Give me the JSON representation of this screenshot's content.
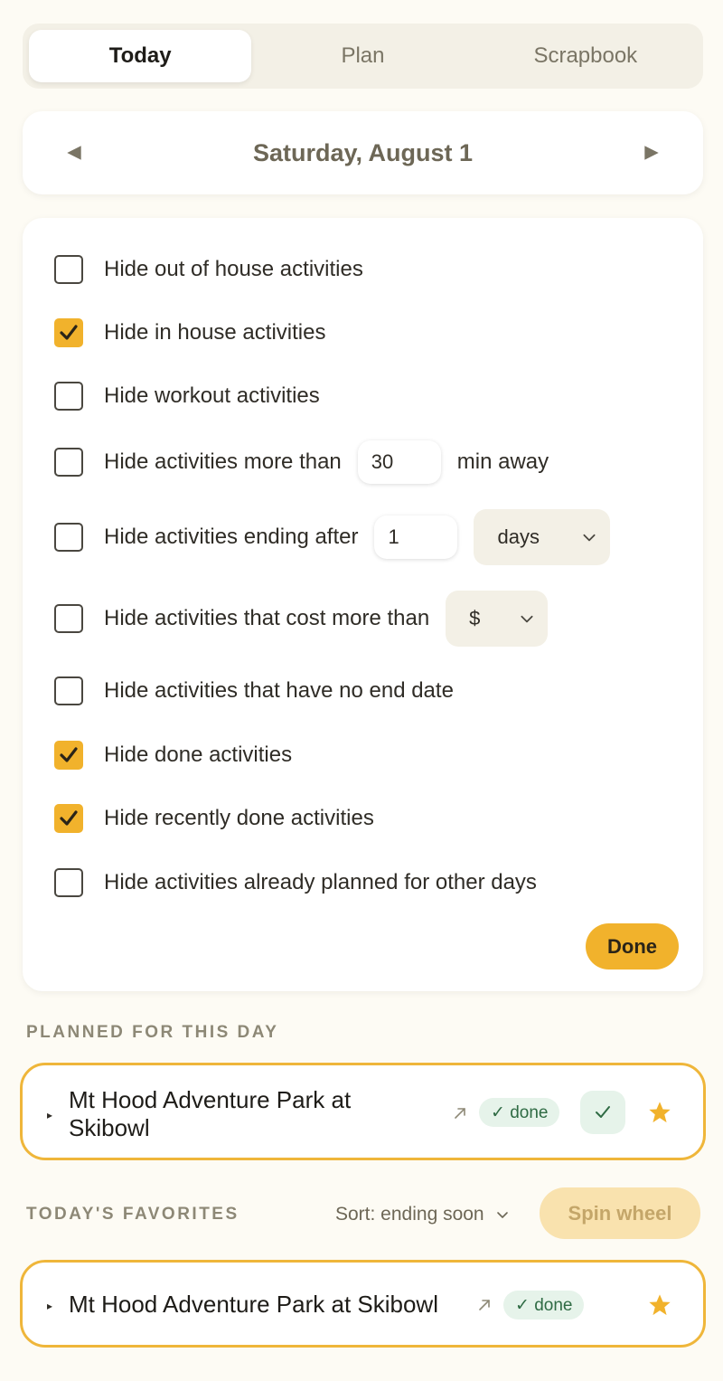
{
  "tabs": [
    {
      "label": "Today",
      "active": true
    },
    {
      "label": "Plan",
      "active": false
    },
    {
      "label": "Scrapbook",
      "active": false
    }
  ],
  "date_nav": {
    "date": "Saturday, August 1"
  },
  "filters": {
    "out_of_house": {
      "label": "Hide out of house activities",
      "checked": false
    },
    "in_house": {
      "label": "Hide in house activities",
      "checked": true
    },
    "workout": {
      "label": "Hide workout activities",
      "checked": false
    },
    "distance": {
      "label": "Hide activities more than",
      "value": "30",
      "suffix": "min away",
      "checked": false
    },
    "ending_after": {
      "label": "Hide activities ending after",
      "value": "1",
      "unit": "days",
      "checked": false
    },
    "cost": {
      "label": "Hide activities that cost more than",
      "value": "$",
      "checked": false
    },
    "no_end_date": {
      "label": "Hide activities that have no end date",
      "checked": false
    },
    "done": {
      "label": "Hide done activities",
      "checked": true
    },
    "recently_done": {
      "label": "Hide recently done activities",
      "checked": true
    },
    "planned_other": {
      "label": "Hide activities already planned for other days",
      "checked": false
    },
    "done_button": "Done"
  },
  "planned": {
    "section_label": "PLANNED FOR THIS DAY",
    "item": {
      "title_line1": "Mt Hood Adventure Park at",
      "title_line2": "Skibowl",
      "badge": "✓ done"
    }
  },
  "favorites": {
    "section_label": "TODAY'S FAVORITES",
    "sort_label": "Sort: ending soon",
    "spin_label": "Spin wheel",
    "item": {
      "title": "Mt Hood Adventure Park at Skibowl",
      "badge": "✓ done"
    }
  },
  "colors": {
    "accent": "#f1b22c",
    "card_border": "#efb63a",
    "done_badge_bg": "#e6f3ea",
    "done_badge_text": "#2f6b44"
  }
}
